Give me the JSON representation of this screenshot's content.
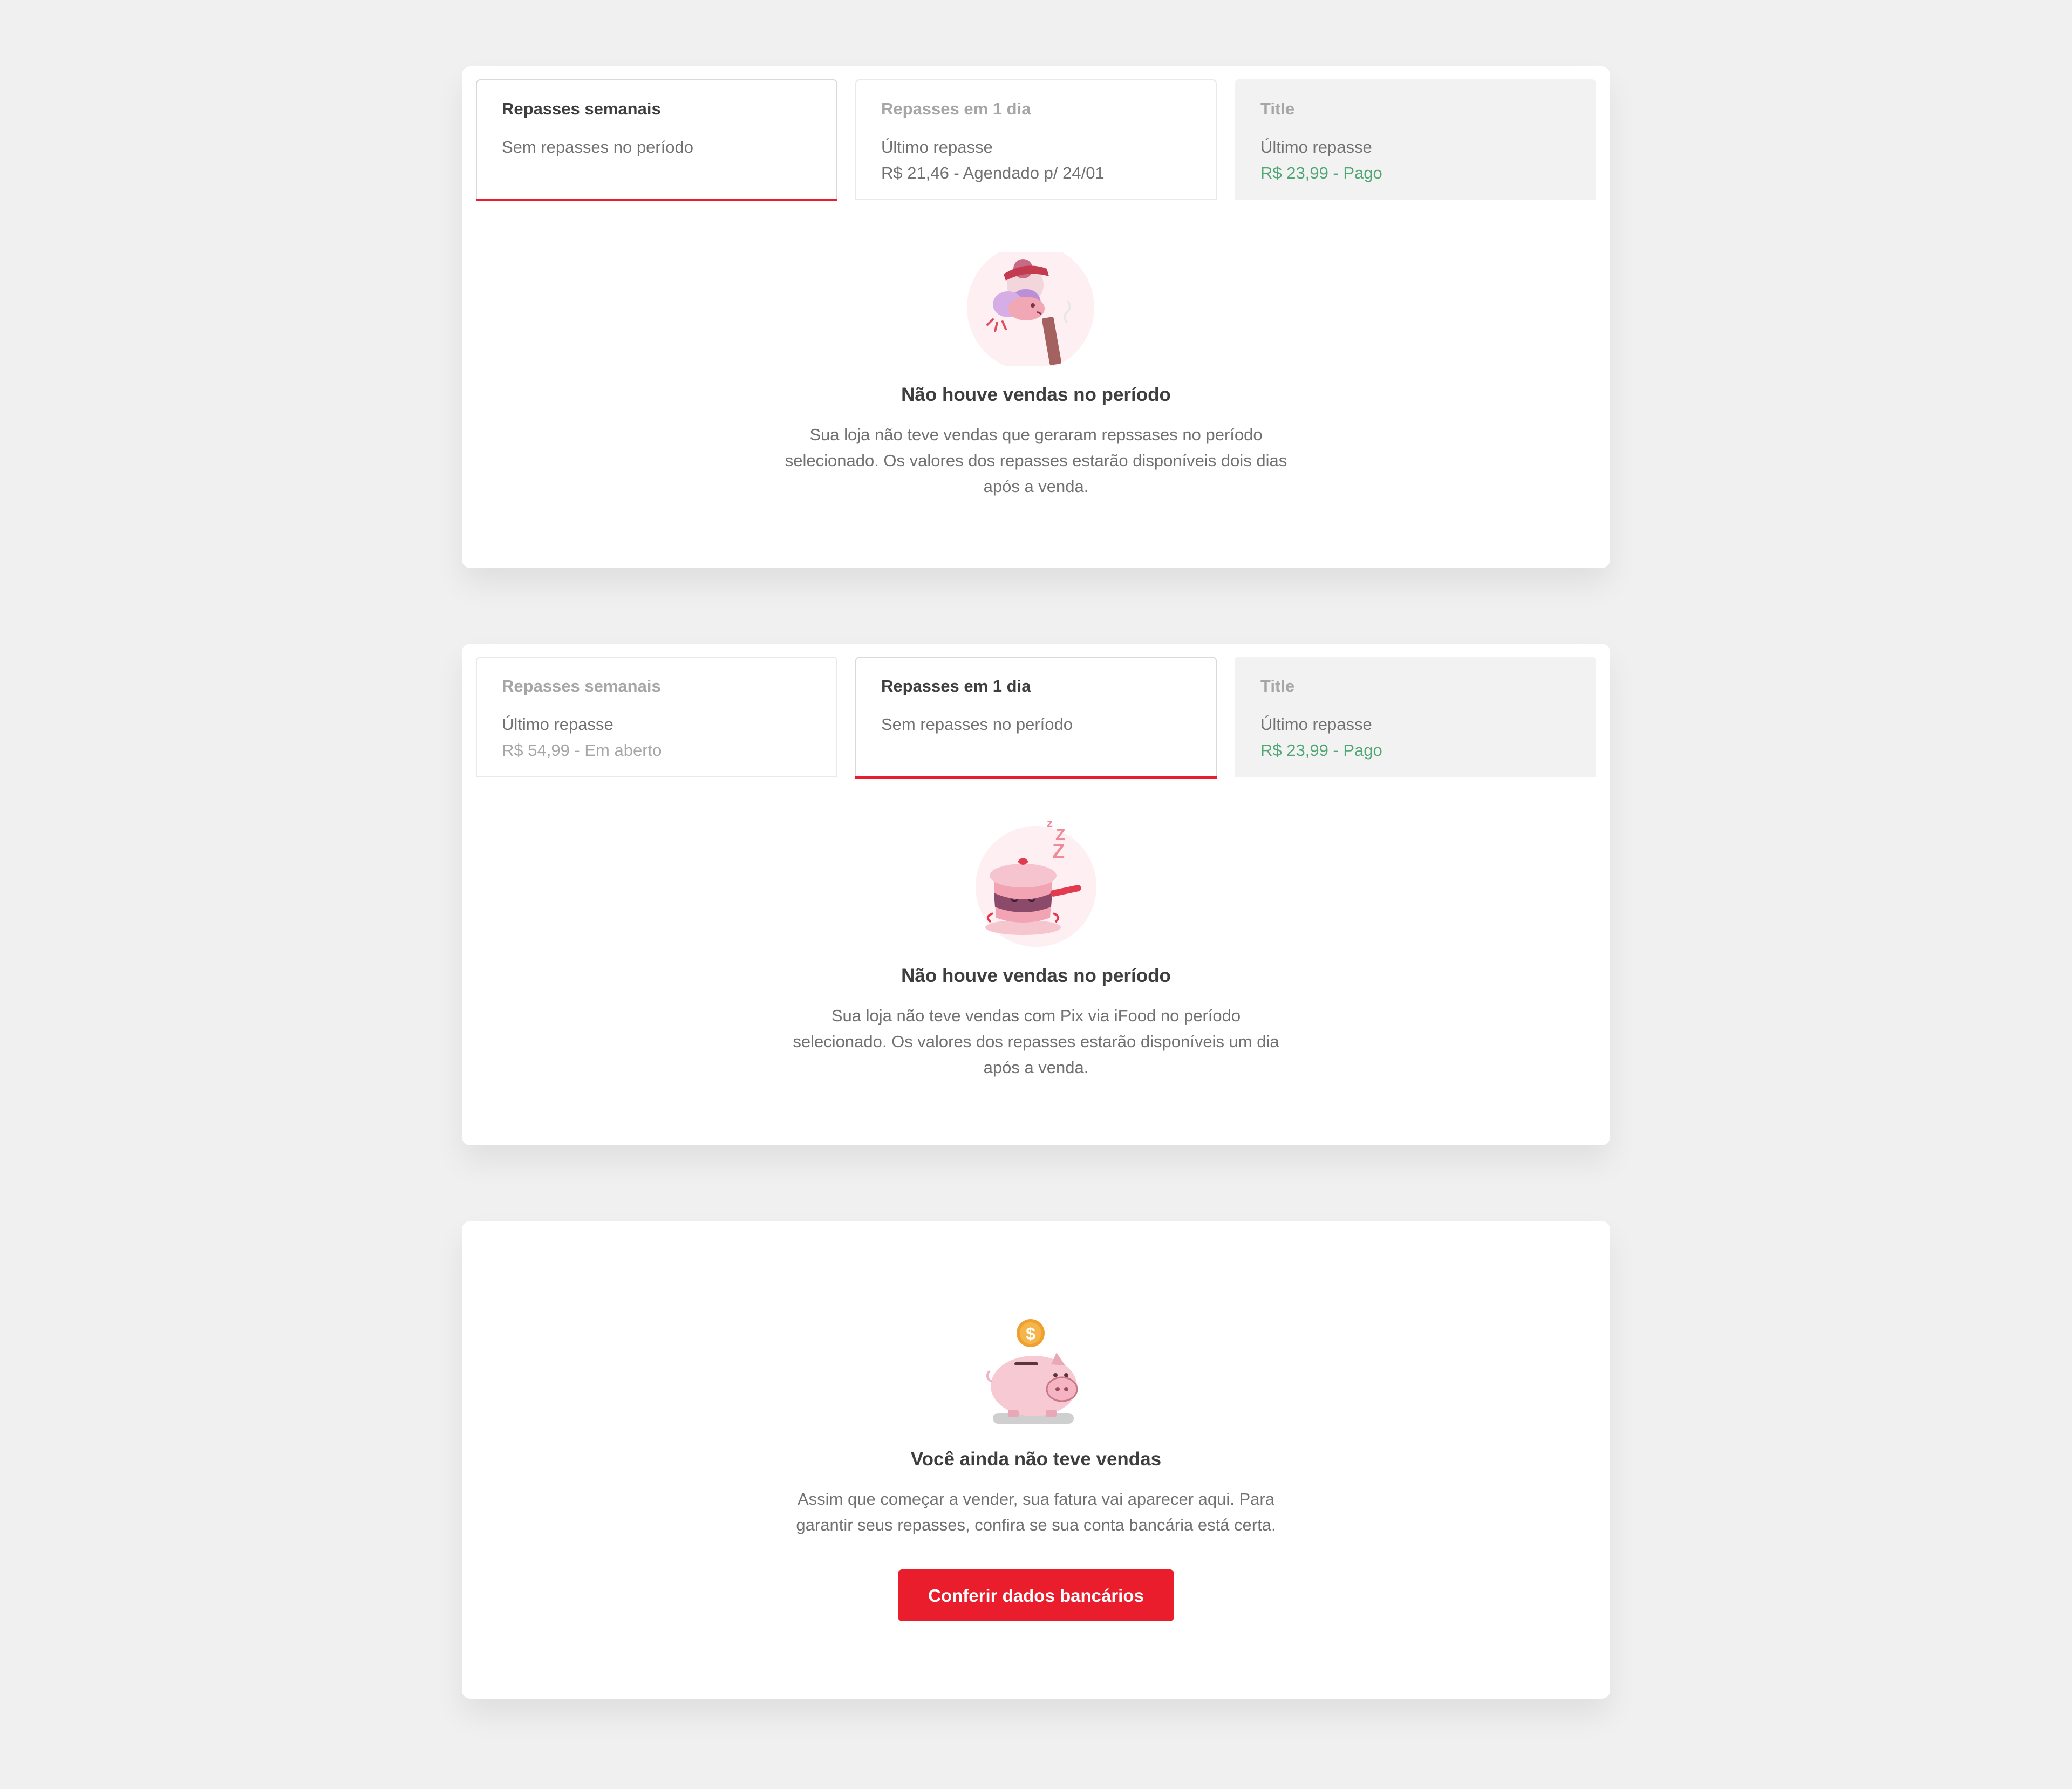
{
  "cards": [
    {
      "tabs": [
        {
          "title": "Repasses semanais",
          "line1": "Sem repasses no período",
          "line2": "",
          "active": true
        },
        {
          "title": "Repasses em 1 dia",
          "line1": "Último repasse",
          "line2": "R$ 21,46 - Agendado p/ 24/01",
          "active": false
        },
        {
          "title": "Title",
          "line1": "Último repasse",
          "line2": "R$ 23,99 - Pago",
          "active": false
        }
      ],
      "empty": {
        "title": "Não houve vendas no período",
        "text": "Sua loja não teve vendas que geraram repssases no período selecionado. Os valores dos repasses estarão disponíveis dois dias após a venda."
      }
    },
    {
      "tabs": [
        {
          "title": "Repasses semanais",
          "line1": "Último repasse",
          "line2": "R$ 54,99 - Em aberto",
          "active": false
        },
        {
          "title": "Repasses em 1 dia",
          "line1": "Sem repasses no período",
          "line2": "",
          "active": true
        },
        {
          "title": "Title",
          "line1": "Último repasse",
          "line2": "R$ 23,99 - Pago",
          "active": false
        }
      ],
      "empty": {
        "title": "Não houve vendas no período",
        "text": "Sua loja não teve vendas com Pix via iFood no período selecionado. Os valores dos repasses estarão disponíveis um dia após a venda."
      }
    },
    {
      "empty": {
        "title": "Você ainda não teve vendas",
        "text": "Assim que começar a vender, sua fatura vai aparecer aqui. Para garantir seus repasses, confira se sua conta bancária está certa.",
        "button_label": "Conferir dados bancários"
      }
    }
  ],
  "colors": {
    "accent": "#ea1d2c",
    "paid_green": "#50a773",
    "background": "#f0f0f0"
  },
  "icons": {
    "card1": "chef-cooking-illustration",
    "card2": "sleeping-pot-illustration",
    "card3": "piggy-bank-illustration"
  }
}
